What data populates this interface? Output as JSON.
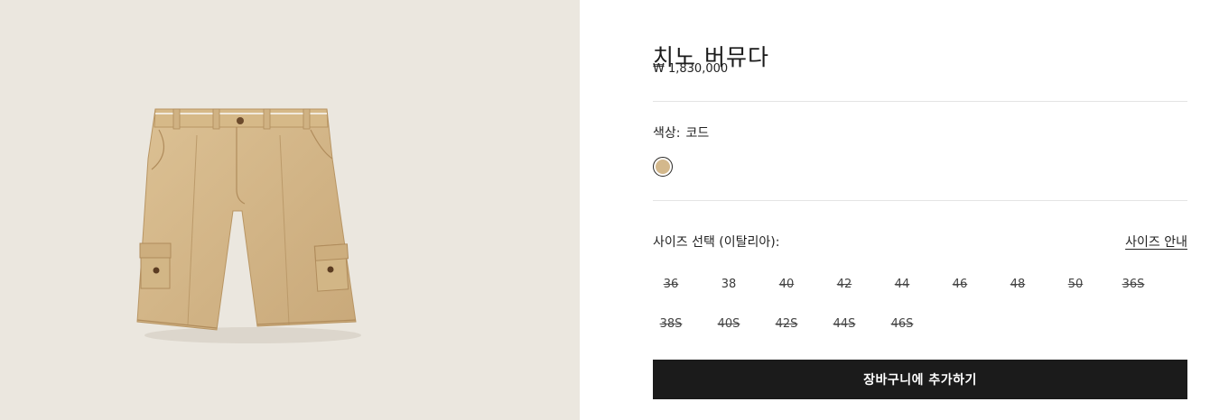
{
  "product": {
    "title": "치노 버뮤다",
    "price": "₩ 1,830,000",
    "image_icon": "chino-bermuda-shorts-image"
  },
  "color": {
    "label": "색상:",
    "value": "코드",
    "swatches": [
      {
        "name": "코드",
        "hex": "#d3b88c",
        "selected": true
      }
    ]
  },
  "size": {
    "label": "사이즈 선택 (이탈리아):",
    "guide_label": "사이즈 안내",
    "options": [
      {
        "label": "36",
        "available": false
      },
      {
        "label": "38",
        "available": true
      },
      {
        "label": "40",
        "available": false
      },
      {
        "label": "42",
        "available": false
      },
      {
        "label": "44",
        "available": false
      },
      {
        "label": "46",
        "available": false
      },
      {
        "label": "48",
        "available": false
      },
      {
        "label": "50",
        "available": false
      },
      {
        "label": "36S",
        "available": false
      },
      {
        "label": "38S",
        "available": false
      },
      {
        "label": "40S",
        "available": false
      },
      {
        "label": "42S",
        "available": false
      },
      {
        "label": "44S",
        "available": false
      },
      {
        "label": "46S",
        "available": false
      }
    ]
  },
  "cart": {
    "button_label": "장바구니에 추가하기"
  }
}
